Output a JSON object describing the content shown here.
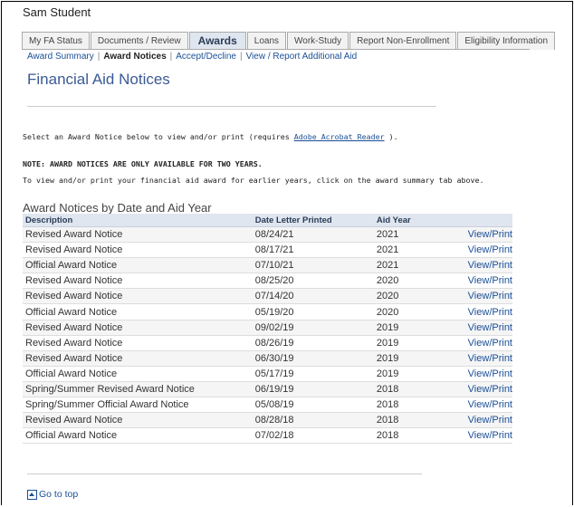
{
  "student_name": "Sam Student",
  "tabs": [
    {
      "label": "My FA Status",
      "active": false
    },
    {
      "label": "Documents / Review",
      "active": false
    },
    {
      "label": "Awards",
      "active": true
    },
    {
      "label": "Loans",
      "active": false
    },
    {
      "label": "Work-Study",
      "active": false
    },
    {
      "label": "Report Non-Enrollment",
      "active": false
    },
    {
      "label": "Eligibility Information",
      "active": false
    }
  ],
  "subnav": {
    "award_summary": "Award Summary",
    "award_notices": "Award Notices",
    "accept_decline": "Accept/Decline",
    "view_report_aid": "View / Report Additional Aid",
    "separator": "|"
  },
  "page_title": "Financial Aid Notices",
  "intro": {
    "text_before": "Select an Award Notice below to view and/or print (requires ",
    "link": "Adobe Acrobat Reader",
    "text_after": " )."
  },
  "note_heading": "NOTE: AWARD NOTICES ARE ONLY AVAILABLE FOR TWO YEARS.",
  "note_body": "To view and/or print your financial aid award for earlier years, click on the award summary tab above.",
  "table": {
    "title": "Award Notices by Date and Aid Year",
    "headers": [
      "Description",
      "Date Letter Printed",
      "Aid Year",
      ""
    ],
    "rows": [
      {
        "description": "Revised Award Notice",
        "date": "08/24/21",
        "year": "2021",
        "action": "View/Print"
      },
      {
        "description": "Revised Award Notice",
        "date": "08/17/21",
        "year": "2021",
        "action": "View/Print"
      },
      {
        "description": "Official Award Notice",
        "date": "07/10/21",
        "year": "2021",
        "action": "View/Print"
      },
      {
        "description": "Revised Award Notice",
        "date": "08/25/20",
        "year": "2020",
        "action": "View/Print"
      },
      {
        "description": "Revised Award Notice",
        "date": "07/14/20",
        "year": "2020",
        "action": "View/Print"
      },
      {
        "description": "Official Award Notice",
        "date": "05/19/20",
        "year": "2020",
        "action": "View/Print"
      },
      {
        "description": "Revised Award Notice",
        "date": "09/02/19",
        "year": "2019",
        "action": "View/Print"
      },
      {
        "description": "Revised Award Notice",
        "date": "08/26/19",
        "year": "2019",
        "action": "View/Print"
      },
      {
        "description": "Revised Award Notice",
        "date": "06/30/19",
        "year": "2019",
        "action": "View/Print"
      },
      {
        "description": "Official Award Notice",
        "date": "05/17/19",
        "year": "2019",
        "action": "View/Print"
      },
      {
        "description": "Spring/Summer Revised Award Notice",
        "date": "06/19/19",
        "year": "2018",
        "action": "View/Print"
      },
      {
        "description": "Spring/Summer Official Award Notice",
        "date": "05/08/19",
        "year": "2018",
        "action": "View/Print"
      },
      {
        "description": "Revised Award Notice",
        "date": "08/28/18",
        "year": "2018",
        "action": "View/Print"
      },
      {
        "description": "Official Award Notice",
        "date": "07/02/18",
        "year": "2018",
        "action": "View/Print"
      }
    ]
  },
  "go_to_top": "Go to top",
  "colors": {
    "link": "#1a4f97",
    "title": "#3a5a94",
    "header_bg": "#dfe6ef"
  }
}
